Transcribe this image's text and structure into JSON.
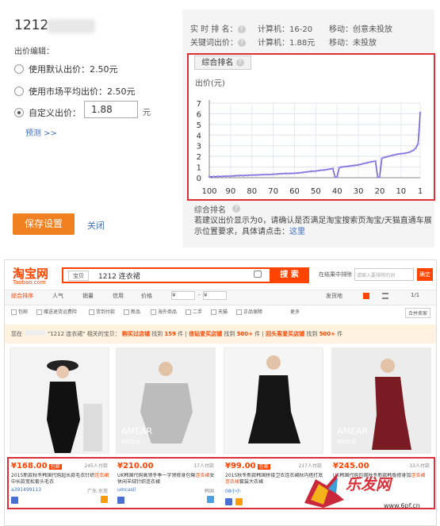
{
  "bid_panel": {
    "keyword": "1212",
    "section_label": "出价编辑：",
    "options": [
      {
        "label": "使用默认出价：2.50元",
        "selected": false
      },
      {
        "label": "使用市场平均出价：2.50元",
        "selected": false
      },
      {
        "label": "自定义出价：",
        "selected": true
      }
    ],
    "custom_bid_value": "1.88",
    "unit": "元",
    "predict_link": "预测 >>",
    "save_button": "保存设置",
    "close_link": "关闭"
  },
  "rank_info": {
    "row1_label": "实 时 排 名：",
    "row1_pc": "计算机：16-20",
    "row1_mobile": "移动：创意未投放",
    "row2_label": "关键词出价：",
    "row2_pc": "计算机：1.88元",
    "row2_mobile": "移动：未投放"
  },
  "chart_panel": {
    "tab_label": "综合排名",
    "bottom_label": "综合排名",
    "note": "若建议出价显示为0，请确认是否满足淘宝搜索页淘宝/天猫直通车展示位置要求，具体请点击：",
    "note_link": "这里"
  },
  "chart_data": {
    "type": "line",
    "ylabel": "出价(元)",
    "xlabel": "",
    "x_ticks": [
      100,
      90,
      80,
      70,
      60,
      50,
      40,
      30,
      20,
      10,
      1
    ],
    "y_ticks": [
      0,
      1,
      2,
      3,
      4,
      5,
      6,
      7
    ],
    "xlim": [
      100,
      1
    ],
    "ylim": [
      0,
      7
    ],
    "grid": true,
    "series": [
      {
        "color": "#6a5acd",
        "x": [
          100,
          98,
          96,
          94,
          92,
          90,
          88,
          86,
          84,
          82,
          80,
          78,
          76,
          74,
          72,
          70,
          68,
          66,
          64,
          62,
          60,
          58,
          56,
          54,
          52,
          50,
          48,
          46,
          44,
          42,
          41,
          40,
          39,
          38,
          36,
          34,
          32,
          30,
          28,
          26,
          24,
          22,
          21,
          20,
          19,
          18,
          16,
          14,
          12,
          10,
          8,
          6,
          4,
          3,
          2,
          1.5,
          1
        ],
        "y": [
          0.1,
          0.1,
          0.12,
          0.12,
          0.15,
          0.15,
          0.18,
          0.2,
          0.2,
          0.22,
          0.25,
          0.25,
          0.28,
          0.3,
          0.3,
          0.32,
          0.35,
          0.38,
          0.4,
          0.4,
          0.42,
          0.45,
          0.5,
          0.55,
          0.6,
          0.62,
          0.7,
          0.72,
          0.8,
          0.85,
          0.1,
          0.1,
          0.95,
          1.0,
          1.05,
          1.1,
          1.15,
          1.2,
          1.3,
          1.4,
          1.5,
          1.55,
          0.1,
          0.1,
          1.8,
          1.9,
          2.0,
          2.1,
          2.2,
          2.25,
          2.3,
          2.4,
          2.6,
          2.8,
          3.2,
          4.5,
          6.1
        ]
      }
    ]
  },
  "taobao": {
    "logo": "淘宝网",
    "logo_sub": "Taobao.com",
    "search_scope": "宝贝",
    "search_query": "1212 连衣裙",
    "search_button": "搜 索",
    "filter_label": "在结果中排除",
    "filter_placeholder": "请输入要排除的词",
    "filter_ok": "确定",
    "sorts": [
      "综合排序",
      "人气",
      "销量",
      "信用",
      "价格",
      "¥",
      "-",
      "¥",
      "发货地",
      "1/1"
    ],
    "checkboxes": [
      "包邮",
      "赠送退货运费险",
      "货到付款",
      "新品",
      "海外商品",
      "二手",
      "天猫",
      "正品保障",
      "更多",
      "合并卖家"
    ],
    "notice_prefix": "您在",
    "notice_mid": "\"1212 连衣裙\" 相关的宝贝：",
    "notice_a": "购买过店铺",
    "notice_a_label": "找到",
    "notice_a_count": "159",
    "notice_a_unit": "件",
    "notice_b": "信钻爱买店铺",
    "notice_b_count": "500+",
    "notice_c": "回头客爱买店铺",
    "notice_c_count": "500+",
    "products": [
      {
        "price": "¥168.00",
        "tag": "包邮",
        "paid": "245人付款",
        "title_a": "2015新款秋冬韩国代购超长款毛衣针织",
        "title_hl": "连衣裙",
        "title_b": "中长款宽松套头毛衣",
        "seller": "a391499113",
        "loc": "广东 东莞"
      },
      {
        "price": "¥210.00",
        "tag": "",
        "paid": "17人付款",
        "title_a": "UK韩国代购高领冬季一字领修身包臀",
        "title_hl": "连衣裙",
        "title_b": "女休闲羊绒针织连衣裙",
        "seller": "umcasil",
        "loc": "韩国"
      },
      {
        "price": "¥99.00",
        "tag": "包邮",
        "paid": "217人付款",
        "title_a": "2015秋冬新款韩国拼接卫衣连衣裙秋内搭打底",
        "title_hl": "连衣裙",
        "title_b": "套装大衣裙",
        "seller": "08小小",
        "loc": ""
      },
      {
        "price": "¥245.00",
        "tag": "",
        "paid": "33人付款",
        "title_a": "UK韩国代购包邮秋冬新款韩版修身加",
        "title_hl": "连衣裙",
        "title_b": "",
        "seller": "",
        "loc": ""
      }
    ],
    "product_labels": [
      "AMEAR",
      "韩国正品",
      "AMEAR",
      "韩国正品"
    ]
  },
  "watermark": {
    "text": "乐发网",
    "url": "www.6pf.cn"
  }
}
